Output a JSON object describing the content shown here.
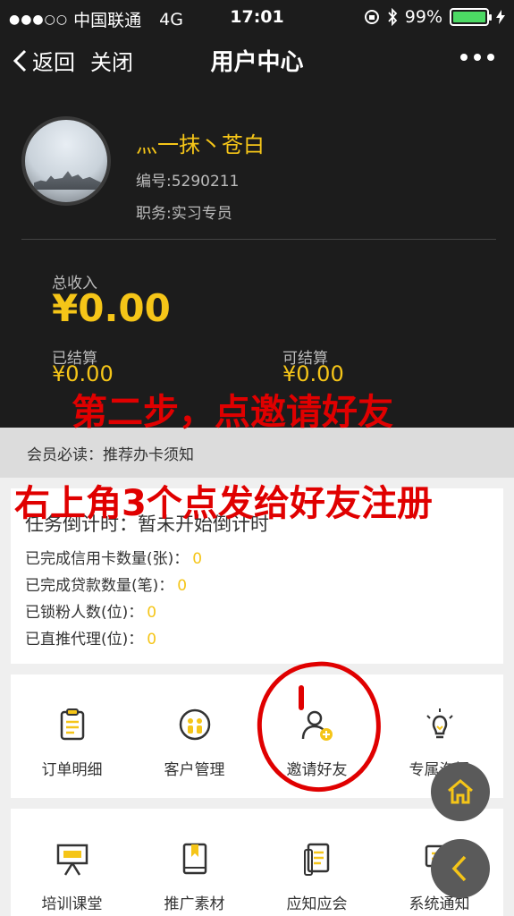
{
  "status_bar": {
    "carrier": "中国联通",
    "network": "4G",
    "time": "17:01",
    "battery": "99%"
  },
  "nav": {
    "back_label": "返回",
    "close_label": "关闭",
    "title": "用户中心"
  },
  "profile": {
    "name": "灬一抹丶苍白",
    "id": "编号:5290211",
    "role": "职务:实习专员",
    "income_label": "总收入",
    "income_value": "¥0.00",
    "settled_label": "已结算",
    "settled_value": "¥0.00",
    "settleable_label": "可结算",
    "settleable_value": "¥0.00"
  },
  "overlay": {
    "step_text": "第二步，点邀请好友",
    "hint_text": "右上角3个点发给好友注册"
  },
  "notice": {
    "text": "会员必读：推荐办卡须知"
  },
  "task": {
    "title": "任务倒计时：暂未开始倒计时",
    "rows": [
      {
        "label": "已完成信用卡数量(张)：",
        "count": "0"
      },
      {
        "label": "已完成贷款数量(笔)：",
        "count": "0"
      },
      {
        "label": "已锁粉人数(位)：",
        "count": "0"
      },
      {
        "label": "已直推代理(位)：",
        "count": "0"
      }
    ]
  },
  "grid1": [
    {
      "label": "订单明细",
      "icon": "clipboard-icon"
    },
    {
      "label": "客户管理",
      "icon": "customer-icon"
    },
    {
      "label": "邀请好友",
      "icon": "add-user-icon"
    },
    {
      "label": "专属海报",
      "icon": "lightbulb-icon"
    }
  ],
  "grid2": [
    {
      "label": "培训课堂",
      "icon": "easel-icon"
    },
    {
      "label": "推广素材",
      "icon": "book-icon"
    },
    {
      "label": "应知应会",
      "icon": "document-icon"
    },
    {
      "label": "系统通知",
      "icon": "notification-icon"
    }
  ],
  "colors": {
    "accent": "#f5c518",
    "dark_bg": "#1c1c1c",
    "annotation": "#e00000",
    "battery": "#4cd964"
  }
}
